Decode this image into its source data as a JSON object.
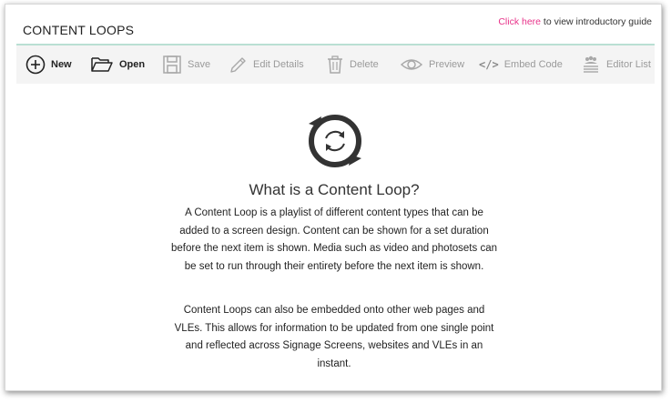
{
  "header": {
    "title": "CONTENT LOOPS",
    "guide_link": "Click here",
    "guide_rest": " to view introductory guide"
  },
  "toolbar": {
    "new": "New",
    "open": "Open",
    "save": "Save",
    "edit_details": "Edit Details",
    "delete": "Delete",
    "preview": "Preview",
    "embed_code": "Embed Code",
    "editor_list": "Editor List"
  },
  "main": {
    "heading": "What is a Content Loop?",
    "paragraph1": "A Content Loop is a playlist of different content types that can be added to a screen design. Content can be shown for a set duration before the next item is shown. Media such as video and photosets can be set to run through their entirety before the next item is shown.",
    "paragraph2": "Content Loops can also be embedded onto other web pages and VLEs. This allows for information to be updated from one single point and reflected across Signage Screens, websites and VLEs in an instant."
  },
  "colors": {
    "accent_link": "#e8338a",
    "divider": "#b9dfd3",
    "toolbar_bg": "#f4f4f4",
    "disabled_text": "#9a9a9a"
  }
}
